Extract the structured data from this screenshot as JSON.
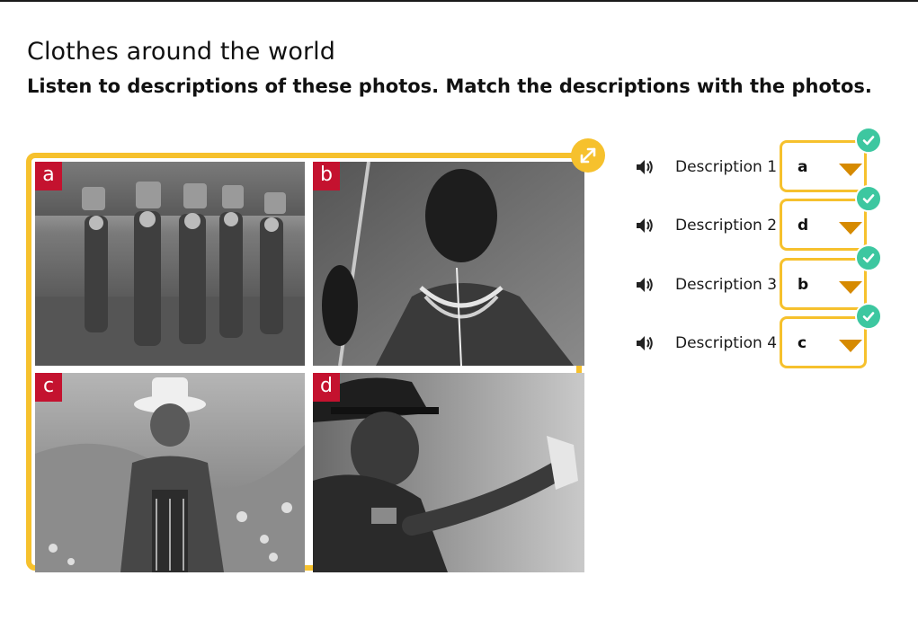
{
  "header": {
    "title": "Clothes around the world",
    "instruction": "Listen to descriptions of these photos. Match the descriptions with the photos."
  },
  "photos": [
    {
      "label": "a",
      "subject": "women carrying pots on heads"
    },
    {
      "label": "b",
      "subject": "man with spear"
    },
    {
      "label": "c",
      "subject": "smiling woman in hat"
    },
    {
      "label": "d",
      "subject": "police officer"
    }
  ],
  "expand_icon": "expand-arrows-icon",
  "descriptions": [
    {
      "label": "Description 1",
      "answer": "a",
      "correct": true
    },
    {
      "label": "Description 2",
      "answer": "d",
      "correct": true
    },
    {
      "label": "Description 3",
      "answer": "b",
      "correct": true
    },
    {
      "label": "Description 4",
      "answer": "c",
      "correct": true
    }
  ],
  "colors": {
    "frame": "#f6c12d",
    "label_bg": "#c4122f",
    "caret": "#d68a00",
    "check": "#3dc7a0"
  }
}
